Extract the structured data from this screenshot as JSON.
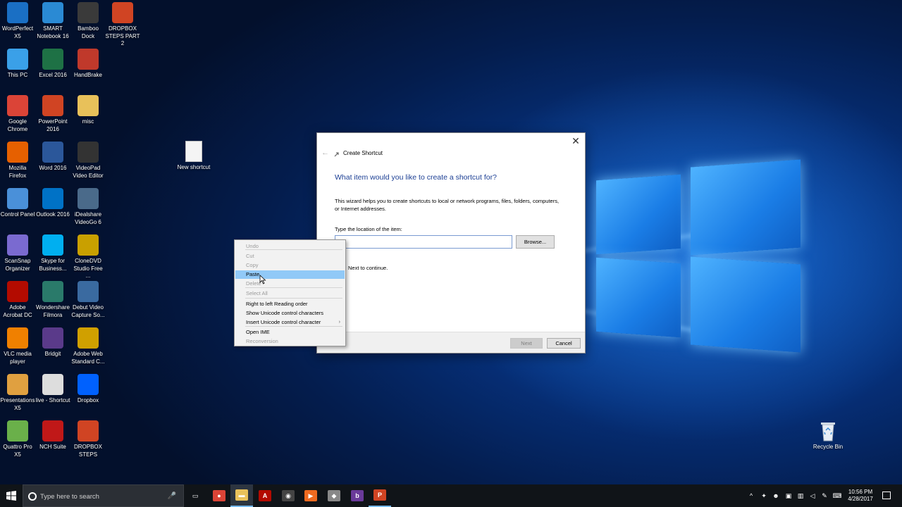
{
  "desktop": {
    "icons": [
      {
        "label": "WordPerfect X5",
        "icon": "wordperfect-icon",
        "color": "#1a6fc4"
      },
      {
        "label": "SMART Notebook 16",
        "icon": "smart-notebook-icon",
        "color": "#2a8ad4"
      },
      {
        "label": "Bamboo Dock",
        "icon": "bamboo-dock-icon",
        "color": "#3a3a3a"
      },
      {
        "label": "DROPBOX STEPS PART 2",
        "icon": "powerpoint-file-icon",
        "color": "#d04423"
      },
      {
        "label": "This PC",
        "icon": "this-pc-icon",
        "color": "#3aa0e8"
      },
      {
        "label": "Excel 2016",
        "icon": "excel-icon",
        "color": "#1e7145"
      },
      {
        "label": "HandBrake",
        "icon": "handbrake-icon",
        "color": "#c0392b"
      },
      {
        "label": "Google Chrome",
        "icon": "chrome-icon",
        "color": "#db4437"
      },
      {
        "label": "PowerPoint 2016",
        "icon": "powerpoint-icon",
        "color": "#d04423"
      },
      {
        "label": "misc",
        "icon": "folder-icon",
        "color": "#e8c15a"
      },
      {
        "label": "Mozilla Firefox",
        "icon": "firefox-icon",
        "color": "#e66000"
      },
      {
        "label": "Word 2016",
        "icon": "word-icon",
        "color": "#2b579a"
      },
      {
        "label": "VideoPad Video Editor",
        "icon": "videopad-icon",
        "color": "#333333"
      },
      {
        "label": "Control Panel",
        "icon": "control-panel-icon",
        "color": "#4a90d9"
      },
      {
        "label": "Outlook 2016",
        "icon": "outlook-icon",
        "color": "#0072c6"
      },
      {
        "label": "iDealshare VideoGo 6",
        "icon": "videogo-icon",
        "color": "#4a6a8a"
      },
      {
        "label": "ScanSnap Organizer",
        "icon": "scansnap-icon",
        "color": "#7a6ad0"
      },
      {
        "label": "Skype for Business...",
        "icon": "skype-icon",
        "color": "#00aff0"
      },
      {
        "label": "CloneDVD Studio Free ...",
        "icon": "clonedvd-icon",
        "color": "#c9a000"
      },
      {
        "label": "Adobe Acrobat DC",
        "icon": "acrobat-icon",
        "color": "#b30b00"
      },
      {
        "label": "Wondershare Filmora",
        "icon": "filmora-icon",
        "color": "#2a7a6a"
      },
      {
        "label": "Debut Video Capture So...",
        "icon": "debut-icon",
        "color": "#3a6aa0"
      },
      {
        "label": "VLC media player",
        "icon": "vlc-icon",
        "color": "#f08000"
      },
      {
        "label": "Bridgit",
        "icon": "bridgit-icon",
        "color": "#5a3a8a"
      },
      {
        "label": "Adobe Web Standard C...",
        "icon": "pdf-file-icon",
        "color": "#d0a000"
      },
      {
        "label": "Presentations X5",
        "icon": "presentations-icon",
        "color": "#e0a040"
      },
      {
        "label": "live - Shortcut",
        "icon": "shortcut-file-icon",
        "color": "#dddddd"
      },
      {
        "label": "Dropbox",
        "icon": "dropbox-icon",
        "color": "#0061fe"
      },
      {
        "label": "Quattro Pro X5",
        "icon": "quattro-pro-icon",
        "color": "#6ab04a"
      },
      {
        "label": "NCH Suite",
        "icon": "nch-suite-icon",
        "color": "#c01818"
      },
      {
        "label": "DROPBOX STEPS",
        "icon": "powerpoint-file-icon",
        "color": "#d04423"
      }
    ],
    "new_shortcut": {
      "label": "New shortcut",
      "icon": "blank-file-icon"
    },
    "recycle_bin": {
      "label": "Recycle Bin",
      "icon": "recycle-bin-icon"
    }
  },
  "dialog": {
    "close_glyph": "✕",
    "back_glyph": "←",
    "title": "Create Shortcut",
    "heading": "What item would you like to create a shortcut for?",
    "description": "This wizard helps you to create shortcuts to local or network programs, files, folders, computers, or Internet addresses.",
    "location_label": "Type the location of the item:",
    "location_value": "",
    "browse_label": "Browse...",
    "hint": "Next to continue.",
    "next_label": "Next",
    "cancel_label": "Cancel"
  },
  "context_menu": {
    "items": [
      {
        "label": "Undo",
        "enabled": false
      },
      {
        "label": "Cut",
        "enabled": false
      },
      {
        "label": "Copy",
        "enabled": false
      },
      {
        "label": "Paste",
        "enabled": true,
        "highlighted": true
      },
      {
        "label": "Delete",
        "enabled": false
      },
      {
        "label": "Select All",
        "enabled": false
      },
      {
        "label": "Right to left Reading order",
        "enabled": true
      },
      {
        "label": "Show Unicode control characters",
        "enabled": true
      },
      {
        "label": "Insert Unicode control character",
        "enabled": true,
        "submenu": true
      },
      {
        "label": "Open IME",
        "enabled": true
      },
      {
        "label": "Reconversion",
        "enabled": false
      }
    ],
    "submenu_arrow": "›"
  },
  "taskbar": {
    "search_placeholder": "Type here to search",
    "mic_glyph": "🎤",
    "apps": [
      {
        "icon": "task-view-icon",
        "glyph": "▭",
        "color": "transparent"
      },
      {
        "icon": "chrome-icon",
        "glyph": "●",
        "color": "#db4437"
      },
      {
        "icon": "file-explorer-icon",
        "glyph": "▬",
        "color": "#e8c15a",
        "active": true
      },
      {
        "icon": "acrobat-icon",
        "glyph": "A",
        "color": "#b30b00"
      },
      {
        "icon": "screen-recorder-icon",
        "glyph": "◉",
        "color": "#444444"
      },
      {
        "icon": "media-app-icon",
        "glyph": "▶",
        "color": "#f06a20"
      },
      {
        "icon": "network-app-icon",
        "glyph": "◆",
        "color": "#888888"
      },
      {
        "icon": "bridgit-icon",
        "glyph": "b",
        "color": "#6a3a9a"
      },
      {
        "icon": "powerpoint-icon",
        "glyph": "P",
        "color": "#d04423",
        "running": true
      }
    ],
    "tray": [
      {
        "icon": "show-hidden-icons-icon",
        "glyph": "^"
      },
      {
        "icon": "dropbox-tray-icon",
        "glyph": "✦"
      },
      {
        "icon": "people-icon",
        "glyph": "☻"
      },
      {
        "icon": "display-icon",
        "glyph": "▣"
      },
      {
        "icon": "network-icon",
        "glyph": "▥"
      },
      {
        "icon": "volume-icon",
        "glyph": "◁"
      },
      {
        "icon": "pen-icon",
        "glyph": "✎"
      },
      {
        "icon": "keyboard-icon",
        "glyph": "⌨"
      }
    ],
    "time": "10:56 PM",
    "date": "4/28/2017"
  }
}
